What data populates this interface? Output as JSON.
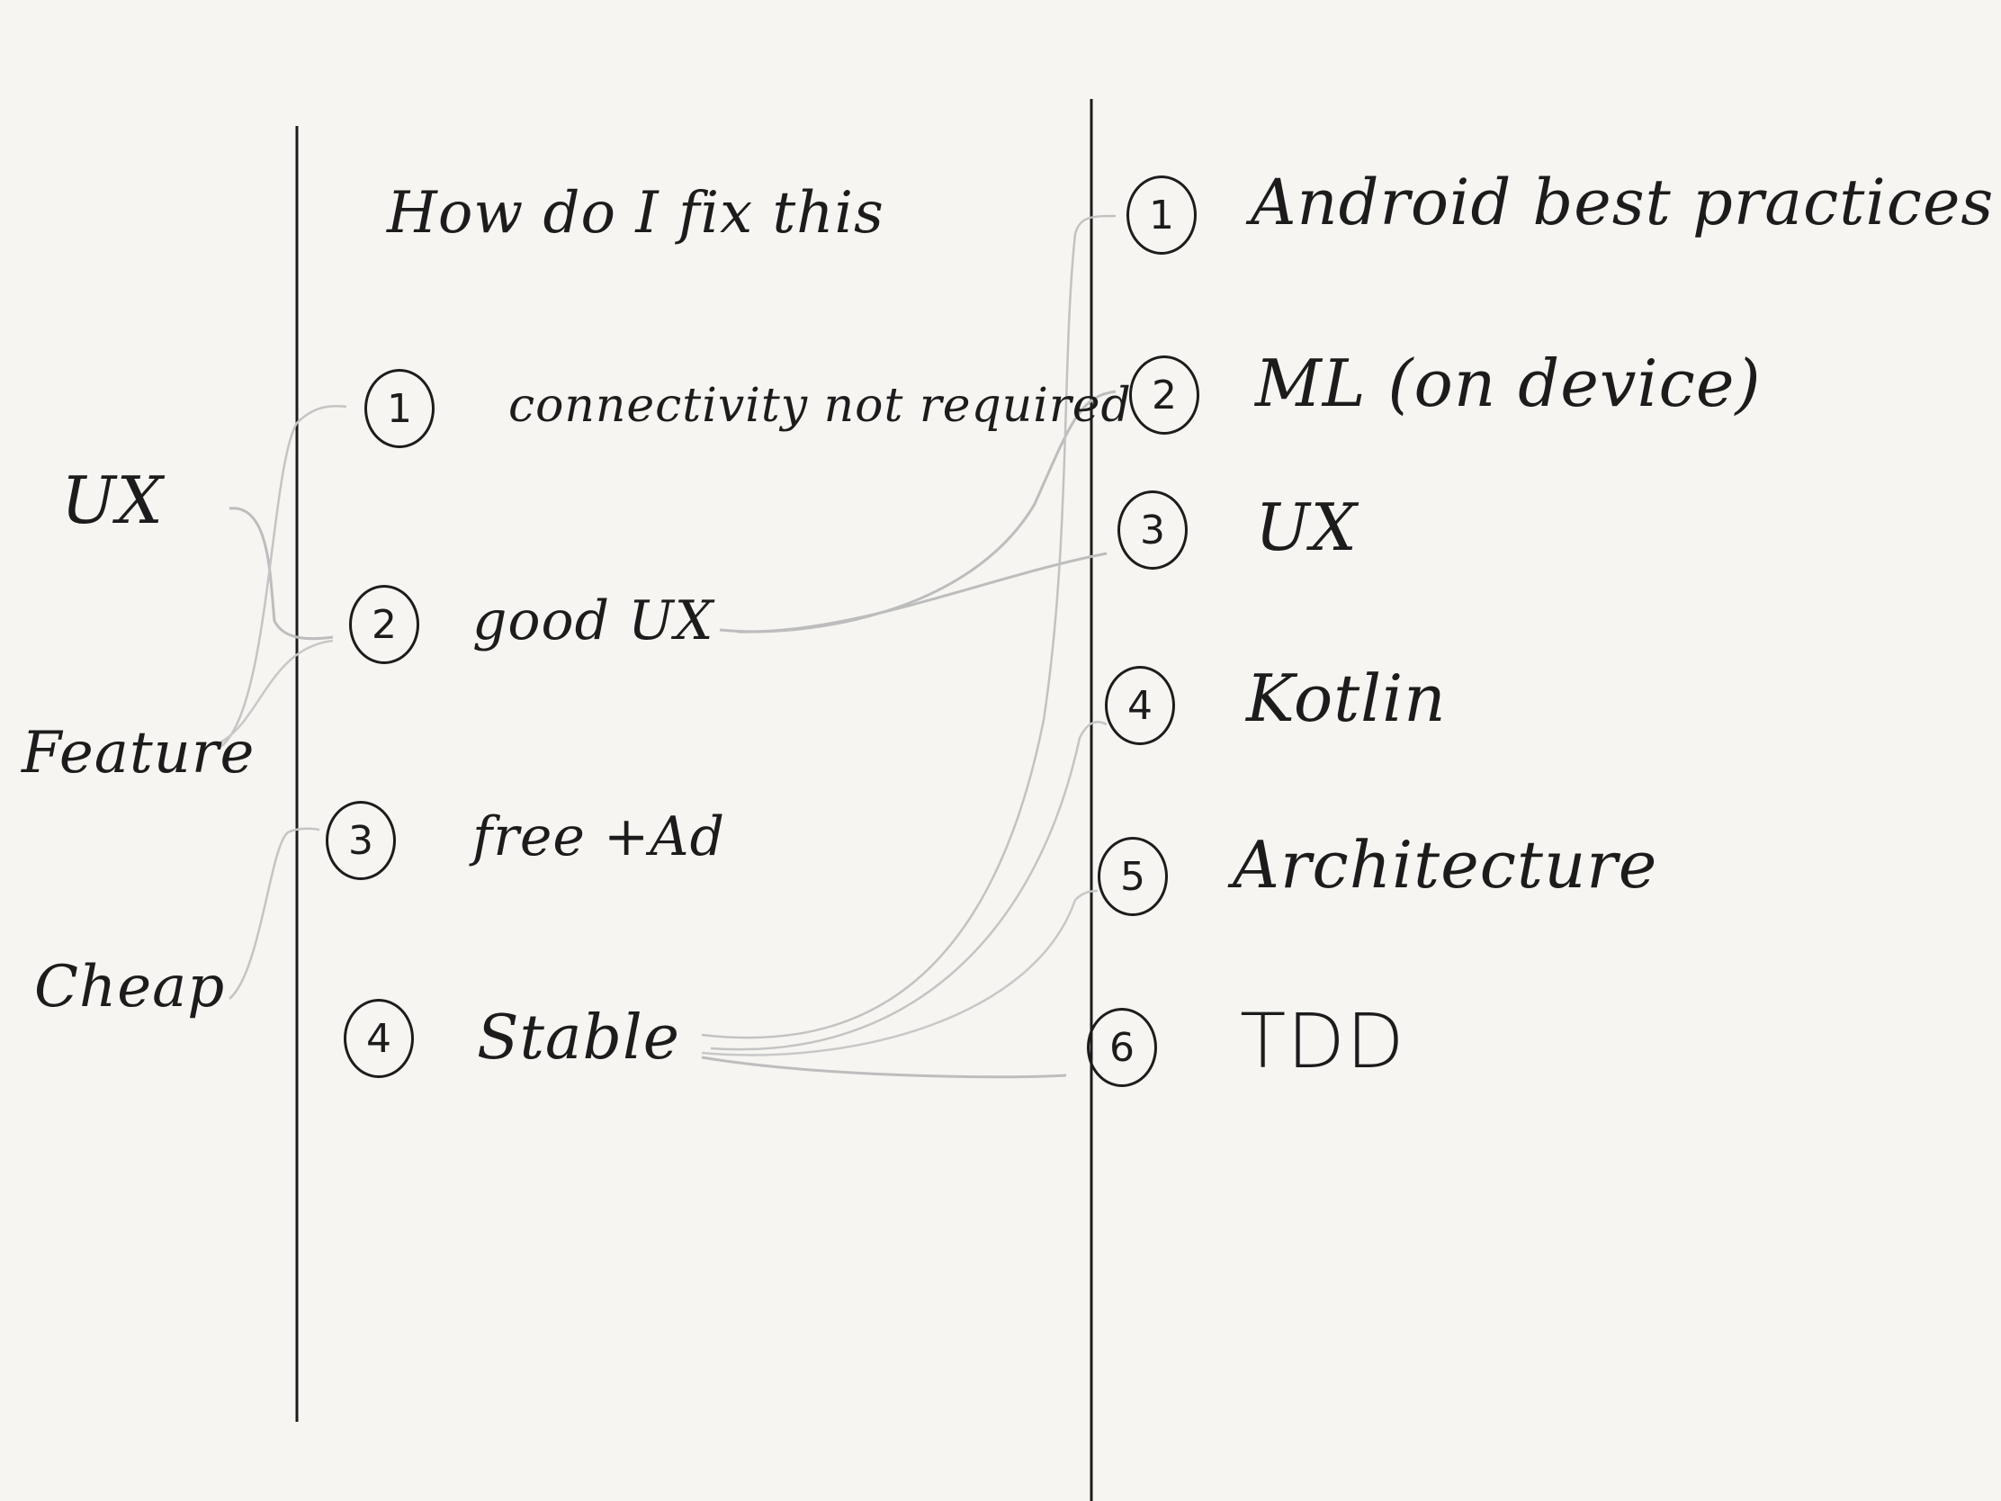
{
  "left": {
    "categories": [
      "UX",
      "Feature",
      "Cheap"
    ]
  },
  "middle": {
    "title": "How do I fix this",
    "items": [
      {
        "num": "1",
        "label": "connectivity not required"
      },
      {
        "num": "2",
        "label": "good UX"
      },
      {
        "num": "3",
        "label": "free +Ad"
      },
      {
        "num": "4",
        "label": "Stable"
      }
    ]
  },
  "right": {
    "items": [
      {
        "num": "1",
        "label": "Android best practices"
      },
      {
        "num": "2",
        "label": "ML (on device)"
      },
      {
        "num": "3",
        "label": "UX"
      },
      {
        "num": "4",
        "label": "Kotlin"
      },
      {
        "num": "5",
        "label": "Architecture"
      },
      {
        "num": "6",
        "label": "TDD"
      }
    ]
  },
  "colors": {
    "ink": "#1c1c1c",
    "pencil": "#bdbdbd",
    "paper": "#f6f5f1"
  }
}
